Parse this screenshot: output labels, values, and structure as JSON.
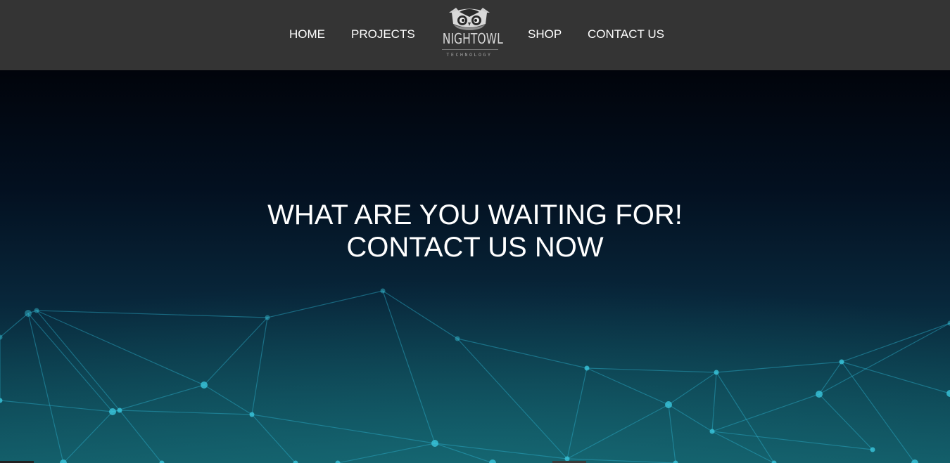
{
  "nav": {
    "items_left": [
      "HOME",
      "PROJECTS"
    ],
    "items_right": [
      "SHOP",
      "CONTACT US"
    ],
    "logo": {
      "wordmark": "NIGHTOWL",
      "tagline": "TECHNOLOGY",
      "icon": "owl-icon"
    }
  },
  "hero": {
    "headline_line1": "WHAT ARE YOU WAITING FOR!",
    "headline_line2": "CONTACT US NOW",
    "background": "network-mesh-graphic"
  },
  "colors": {
    "navbar": "#343434",
    "hero_top": "#01040b",
    "hero_bottom": "#125a66",
    "mesh": "#2aa7c9",
    "text": "#ffffff"
  }
}
